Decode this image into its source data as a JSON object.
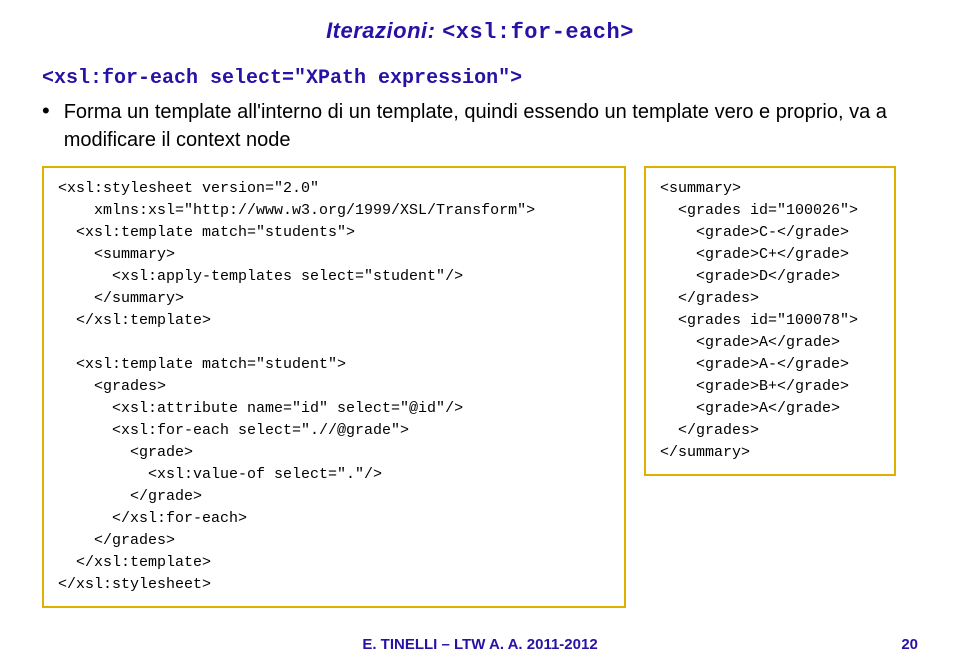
{
  "title_prefix": "Iterazioni: ",
  "title_tag": "<xsl:for-each>",
  "heading": "<xsl:for-each select=\"XPath expression\">",
  "bullet": "Forma un template all'interno di un template, quindi essendo un template vero e proprio, va a modificare il context node",
  "left_code": "<xsl:stylesheet version=\"2.0\"\n    xmlns:xsl=\"http://www.w3.org/1999/XSL/Transform\">\n  <xsl:template match=\"students\">\n    <summary>\n      <xsl:apply-templates select=\"student\"/>\n    </summary>\n  </xsl:template>\n\n  <xsl:template match=\"student\">\n    <grades>\n      <xsl:attribute name=\"id\" select=\"@id\"/>\n      <xsl:for-each select=\".//@grade\">\n        <grade>\n          <xsl:value-of select=\".\"/>\n        </grade>\n      </xsl:for-each>\n    </grades>\n  </xsl:template>\n</xsl:stylesheet>",
  "right_code": "<summary>\n  <grades id=\"100026\">\n    <grade>C-</grade>\n    <grade>C+</grade>\n    <grade>D</grade>\n  </grades>\n  <grades id=\"100078\">\n    <grade>A</grade>\n    <grade>A-</grade>\n    <grade>B+</grade>\n    <grade>A</grade>\n  </grades>\n</summary>",
  "footer_text": "E. TINELLI – LTW  A. A.  2011-2012",
  "footer_page": "20"
}
